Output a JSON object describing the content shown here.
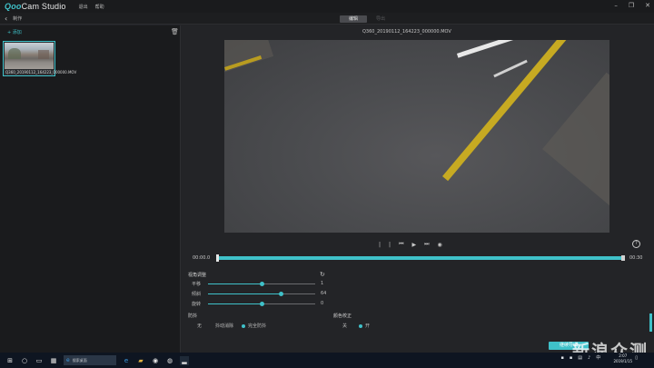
{
  "app": {
    "logo_prefix": "Qoo",
    "logo_rest": "Cam Studio",
    "menu": [
      "退出",
      "帮助"
    ]
  },
  "subbar": {
    "crumb": "制作",
    "tabs": [
      {
        "label": "编辑",
        "active": true
      },
      {
        "label": "导出",
        "active": false
      }
    ]
  },
  "library": {
    "add_label": "+ 添加",
    "items": [
      {
        "label": "Q360_20190112_164223_000000.MOV",
        "selected": true
      }
    ]
  },
  "viewer": {
    "filename": "Q360_20190112_164223_000000.MOV",
    "time_start": "00:00.0",
    "time_end": "00:30",
    "help_label": "?",
    "controls": [
      "|",
      "|",
      "⏮",
      "▶",
      "⏭",
      "◉"
    ]
  },
  "adjust": {
    "title": "视角调整",
    "sliders": [
      {
        "label": "平移",
        "value": "1",
        "fraction": 0.5
      },
      {
        "label": "倾斜",
        "value": "64",
        "fraction": 0.68
      },
      {
        "label": "旋转",
        "value": "0",
        "fraction": 0.5
      }
    ]
  },
  "stabilization": {
    "title": "防抖",
    "options": [
      {
        "label": "无",
        "selected": false
      },
      {
        "label": "抖动消除",
        "selected": false
      },
      {
        "label": "完全防抖",
        "selected": true
      }
    ]
  },
  "color": {
    "title": "颜色校正",
    "options": [
      {
        "label": "关",
        "selected": false
      },
      {
        "label": "开",
        "selected": true
      }
    ]
  },
  "export_label": "继续导出",
  "watermark": "新浪众测",
  "taskbar": {
    "search_placeholder": "搜索桌面",
    "time": "2:07",
    "date": "2019/1/15"
  },
  "colors": {
    "accent": "#3fc1c9",
    "lane_yellow": "#c7aa22"
  }
}
